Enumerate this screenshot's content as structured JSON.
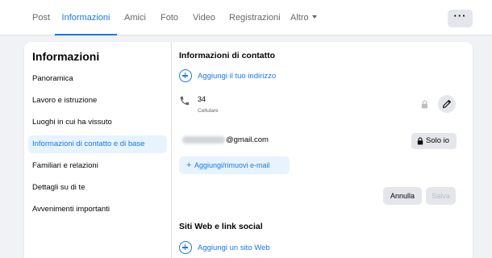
{
  "tabs": [
    {
      "label": "Post"
    },
    {
      "label": "Informazioni"
    },
    {
      "label": "Amici"
    },
    {
      "label": "Foto"
    },
    {
      "label": "Video"
    },
    {
      "label": "Registrazioni"
    },
    {
      "label": "Altro"
    }
  ],
  "more_button": {
    "label": "···"
  },
  "sidebar": {
    "title": "Informazioni",
    "items": [
      {
        "label": "Panoramica"
      },
      {
        "label": "Lavoro e istruzione"
      },
      {
        "label": "Luoghi in cui ha vissuto"
      },
      {
        "label": "Informazioni di contatto e di base"
      },
      {
        "label": "Familiari e relazioni"
      },
      {
        "label": "Dettagli su di te"
      },
      {
        "label": "Avvenimenti importanti"
      }
    ]
  },
  "contact": {
    "title": "Informazioni di contatto",
    "add_address": "Aggiungi il tuo indirizzo",
    "phone_number": "34",
    "phone_type": "Cellulare",
    "email_visible": "@gmail.com",
    "privacy_label": "Solo io",
    "add_email": "Aggiungi/rimuovi e-mail",
    "cancel": "Annulla",
    "save": "Salva"
  },
  "social": {
    "title": "Siti Web e link social",
    "add_site": "Aggiungi un sito Web"
  },
  "colors": {
    "accent": "#1877f2",
    "background": "#f0f2f5",
    "button": "#e4e6eb"
  }
}
